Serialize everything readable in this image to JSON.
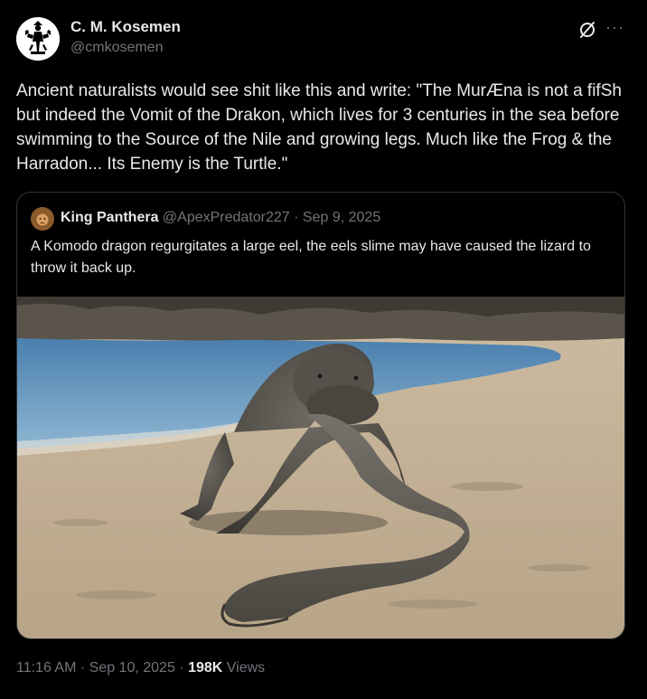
{
  "author": {
    "display_name": "C. M. Kosemen",
    "handle": "@cmkosemen",
    "avatar_icon": "heraldic-figure-avatar",
    "grok_icon": "grok-slash-icon",
    "more_icon": "more-options-icon"
  },
  "tweet": {
    "text": "Ancient naturalists would see shit like this and write: \"The MurÆna is not a fifSh but indeed the Vomit of the Drakon, which lives for 3 centuries in the sea before swimming to the Source of the Nile and growing legs. Much like the Frog & the Harradon... Its Enemy is the Turtle.\""
  },
  "quoted_tweet": {
    "display_name": "King Panthera",
    "handle": "@ApexPredator227",
    "separator": " · ",
    "date": "Sep 9, 2025",
    "avatar_icon": "lion-avatar",
    "text": "A Komodo dragon regurgitates a large eel, the eels slime may have caused the lizard to throw it back up.",
    "media_icon": "komodo-dragon-eel-photo"
  },
  "footer": {
    "time": "11:16 AM",
    "sep1": " · ",
    "date": "Sep 10, 2025",
    "sep2": " · ",
    "views_count": "198K",
    "views_label": " Views"
  },
  "colors": {
    "background": "#000000",
    "text": "#e7e9ea",
    "secondary": "#71767b",
    "border": "#2f3336"
  }
}
